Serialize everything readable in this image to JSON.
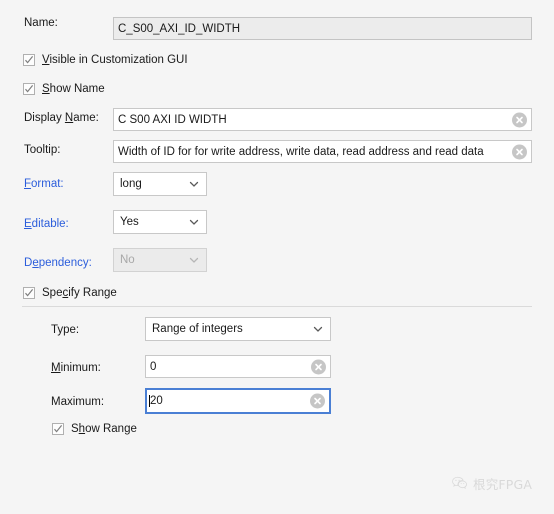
{
  "fields": {
    "name": {
      "label": "Name:",
      "value": "C_S00_AXI_ID_WIDTH",
      "readonly": true
    },
    "display_name": {
      "label_pre": "Display ",
      "label_mnemonic": "N",
      "label_post": "ame:",
      "value": "C S00 AXI ID WIDTH",
      "clear_icon": "clear-circle-icon"
    },
    "tooltip": {
      "label": "Tooltip:",
      "value": "Width of ID for for write address, write data, read address and read data",
      "clear_icon": "clear-circle-icon"
    },
    "format": {
      "label_mnemonic": "F",
      "label_post": "ormat:",
      "value": "long",
      "chevron_icon": "chevron-down-icon",
      "disabled": false
    },
    "editable": {
      "label_mnemonic": "E",
      "label_post": "ditable:",
      "value": "Yes",
      "chevron_icon": "chevron-down-icon",
      "disabled": false
    },
    "dependency": {
      "label_pre": "D",
      "label_mnemonic": "e",
      "label_post": "pendency:",
      "value": "No",
      "chevron_icon": "chevron-down-icon",
      "disabled": true
    }
  },
  "checkboxes": {
    "visible_in_gui": {
      "mnemonic": "V",
      "post": "isible in Customization GUI",
      "checked": true
    },
    "show_name": {
      "mnemonic": "S",
      "post": "how Name",
      "checked": true
    },
    "specify_range": {
      "pre": "Spe",
      "mnemonic": "c",
      "post": "ify Range",
      "checked": true
    },
    "show_range": {
      "pre": "S",
      "mnemonic": "h",
      "post": "ow Range",
      "checked": true
    }
  },
  "range": {
    "type": {
      "label": "Type:",
      "value": "Range of integers",
      "chevron_icon": "chevron-down-icon"
    },
    "minimum": {
      "label_mnemonic": "M",
      "label_post": "inimum:",
      "value": "0",
      "clear_icon": "clear-circle-icon",
      "focused": false
    },
    "maximum": {
      "label": "Maximum:",
      "value": "20",
      "clear_icon": "clear-circle-icon",
      "focused": true
    }
  },
  "watermark": {
    "text": "根究FPGA",
    "logo_icon": "wechat-logo-icon"
  },
  "colors": {
    "background": "#f5f5f5",
    "link": "#2b5ddb",
    "focus_border": "#4a7fd4",
    "field_border": "#c8c8c8",
    "readonly_bg": "#ececec"
  }
}
